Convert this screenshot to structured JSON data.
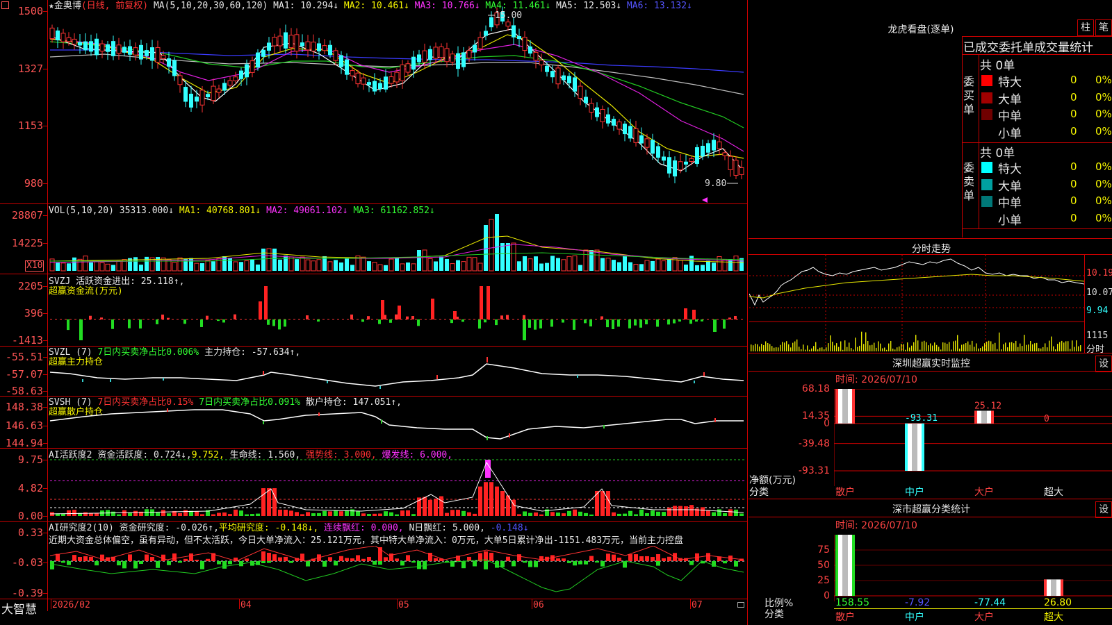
{
  "app": {
    "brand": "大智慧"
  },
  "main": {
    "stock_name": "★金奥博",
    "mode": "(日线, 前复权)",
    "ma_label": "MA(5,10,20,30,60,120)",
    "ma": [
      {
        "label": "MA1: 10.294↓",
        "color": "#e8e8e8"
      },
      {
        "label": "MA2: 10.461↓",
        "color": "#f5f500"
      },
      {
        "label": "MA3: 10.766↓",
        "color": "#ff33ff"
      },
      {
        "label": "MA4: 11.461↓",
        "color": "#33ff33"
      },
      {
        "label": "MA5: 12.503↓",
        "color": "#e8e8e8"
      },
      {
        "label": "MA6: 13.132↓",
        "color": "#5555ff"
      }
    ],
    "high_mark": "15.00",
    "low_mark": "9.80",
    "y_labels": [
      "1500",
      "1327",
      "1153",
      "980"
    ]
  },
  "vol": {
    "title": "VOL(5,10,20)",
    "value": "35313.000↓",
    "ma": [
      {
        "label": "MA1: 40768.801↓",
        "color": "#f5f500"
      },
      {
        "label": "MA2: 49061.102↓",
        "color": "#ff33ff"
      },
      {
        "label": "MA3: 61162.852↓",
        "color": "#33ff33"
      }
    ],
    "y_labels": [
      "28807",
      "14225"
    ],
    "unit": "X10"
  },
  "svzj": {
    "title": "SVZJ",
    "line1": "活跃资金进出: 25.118↑,",
    "line2": "超赢资金流(万元)",
    "y_labels": [
      "2205",
      "396",
      "-1413"
    ]
  },
  "svzl": {
    "title": "SVZL (7)",
    "part1": "7日内买卖净占比0.006%",
    "part2": "主力持仓: -57.634↑,",
    "line2": "超赢主力持仓",
    "y_labels": [
      "-55.51",
      "-57.07",
      "-58.63"
    ]
  },
  "svsh": {
    "title": "SVSH (7)",
    "part1": "7日内买卖净占比0.15%",
    "part2": "7日内买卖净占比0.091%",
    "part3": "散户持仓: 147.051↑,",
    "line2": "超赢散户持仓",
    "y_labels": [
      "148.38",
      "146.63",
      "144.94"
    ]
  },
  "ai1": {
    "title": "AI活跃度2",
    "part1": "资金活跃度: 0.724↓,",
    "part2": "9.752,",
    "part3": "生命线: 1.560,",
    "part4": "强势线: 3.000,",
    "part5": "爆发线: 6.000,",
    "y_labels": [
      "9.75",
      "4.82",
      "0.00"
    ]
  },
  "ai2": {
    "title": "AI研究度2(10)",
    "part1": "资金研究度: -0.026↑,",
    "part2": "平均研究度: -0.148↓,",
    "part3": "连续飘红: 0.000,",
    "part4": "N日飘红: 5.000,",
    "part5": "-0.148↓",
    "comment": "近期大资金总体偏空，虽有异动，但不太活跃，今日大单净流入：25.121万元，其中特大单净流入：0万元，大单5日累计净出-1151.483万元，当前主力控盘",
    "y_labels": [
      "0.33",
      "-0.03",
      "-0.39"
    ]
  },
  "xaxis": {
    "labels": [
      "2026/02",
      "04",
      "05",
      "06",
      "07"
    ]
  },
  "dragon": {
    "title": "龙虎看盘(逐单)",
    "btn1": "柱",
    "btn2": "笔",
    "subtitle": "已成交委托单成交量统计",
    "buy_group": "委买单",
    "sell_group": "委卖单",
    "buy_total": "共 0单",
    "sell_total": "共 0单",
    "buy_rows": [
      {
        "label": "特大",
        "val": "0",
        "pct": "0%",
        "color": "#ff0000"
      },
      {
        "label": "大单",
        "val": "0",
        "pct": "0%",
        "color": "#a00000"
      },
      {
        "label": "中单",
        "val": "0",
        "pct": "0%",
        "color": "#700000"
      },
      {
        "label": "小单",
        "val": "0",
        "pct": "0%",
        "color": "#000000"
      }
    ],
    "sell_rows": [
      {
        "label": "特大",
        "val": "0",
        "pct": "0%",
        "color": "#00ffff"
      },
      {
        "label": "大单",
        "val": "0",
        "pct": "0%",
        "color": "#00a0a0"
      },
      {
        "label": "中单",
        "val": "0",
        "pct": "0%",
        "color": "#007878"
      },
      {
        "label": "小单",
        "val": "0",
        "pct": "0%",
        "color": "#000000"
      }
    ]
  },
  "intraday": {
    "title": "分时走势",
    "y_labels": [
      "10.19",
      "10.07",
      "9.94"
    ],
    "vol_label": "1115",
    "vol_caption": "分时"
  },
  "monitor": {
    "title": "深圳超赢实时监控",
    "btn": "设",
    "time": "时间: 2026/07/10",
    "y_labels": [
      "68.18",
      "14.35",
      "0",
      "-39.48",
      "-93.31"
    ],
    "bar_labels": [
      "68.18",
      "-93.31",
      "25.12",
      "0"
    ],
    "axis_label": "净额(万元)",
    "axis_caption": "分类",
    "categories": [
      "散户",
      "中户",
      "大户",
      "超大"
    ]
  },
  "classify": {
    "title": "深市超赢分类统计",
    "btn": "设",
    "time": "时间: 2026/07/10",
    "y_labels": [
      "75",
      "50",
      "25",
      "0"
    ],
    "values": [
      "158.55",
      "-7.92",
      "-77.44",
      "26.80"
    ],
    "axis_label": "比例%",
    "axis_caption": "分类",
    "categories": [
      "散户",
      "中户",
      "大户",
      "超大"
    ]
  },
  "chart_data": {
    "type": "bar",
    "title": "深圳超赢实时监控",
    "categories": [
      "散户",
      "中户",
      "大户",
      "超大"
    ],
    "values": [
      68.18,
      -93.31,
      25.12,
      0
    ],
    "ylabel": "净额(万元)",
    "ylim": [
      -93.31,
      68.18
    ]
  }
}
